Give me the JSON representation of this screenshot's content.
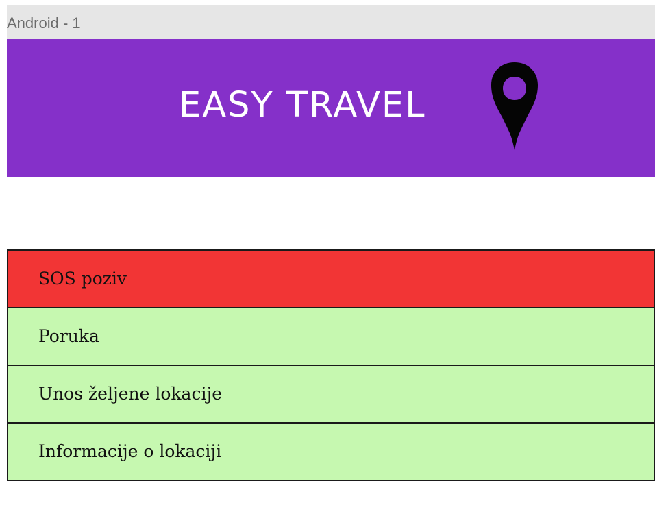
{
  "frame": {
    "label": "Android - 1"
  },
  "header": {
    "title": "EASY TRAVEL",
    "icon": "location-pin-icon",
    "background_color": "#8530c9",
    "title_color": "#ffffff"
  },
  "menu": {
    "items": [
      {
        "label": "SOS poziv",
        "kind": "sos",
        "color": "#f23535"
      },
      {
        "label": "Poruka",
        "kind": "normal",
        "color": "#c6f8b0"
      },
      {
        "label": "Unos željene lokacije",
        "kind": "normal",
        "color": "#c6f8b0"
      },
      {
        "label": "Informacije o lokaciji",
        "kind": "normal",
        "color": "#c6f8b0"
      }
    ]
  }
}
